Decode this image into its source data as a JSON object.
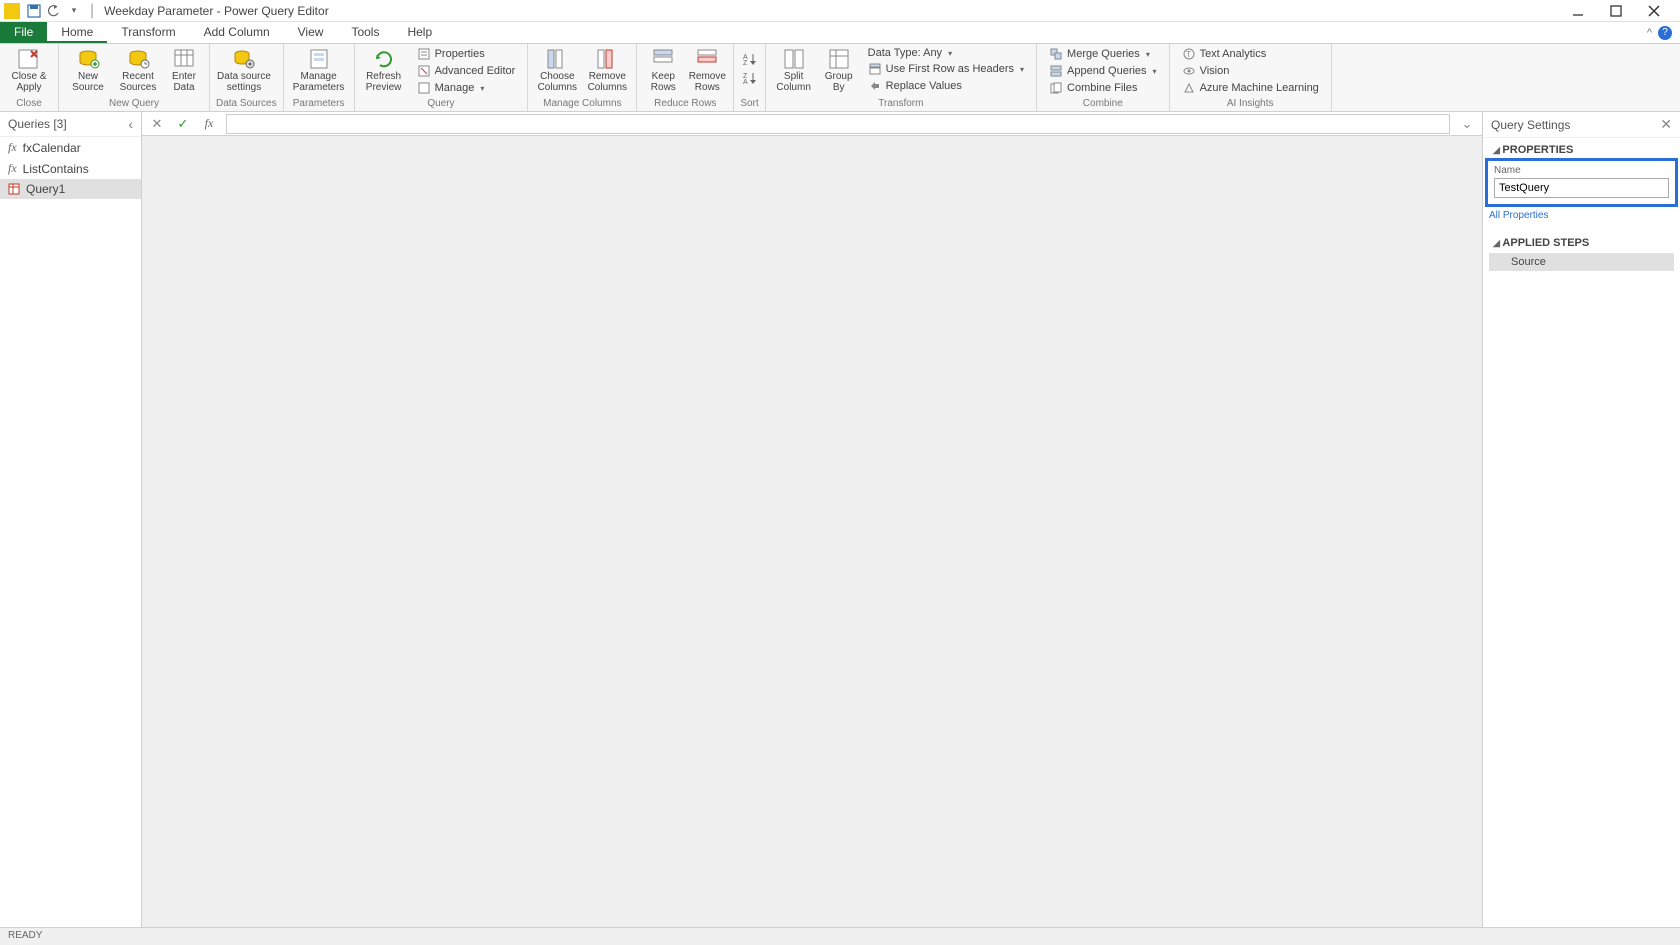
{
  "window": {
    "title": "Weekday Parameter - Power Query Editor",
    "status": "READY"
  },
  "tabs": {
    "file": "File",
    "home": "Home",
    "transform": "Transform",
    "addcol": "Add Column",
    "view": "View",
    "tools": "Tools",
    "help": "Help"
  },
  "ribbon": {
    "close_apply": "Close &\nApply",
    "close_grp": "Close",
    "new_source": "New\nSource",
    "recent_sources": "Recent\nSources",
    "enter_data": "Enter\nData",
    "new_query_grp": "New Query",
    "ds_settings": "Data source\nsettings",
    "ds_grp": "Data Sources",
    "manage_params": "Manage\nParameters",
    "params_grp": "Parameters",
    "refresh": "Refresh\nPreview",
    "properties": "Properties",
    "adv_editor": "Advanced Editor",
    "manage": "Manage",
    "query_grp": "Query",
    "choose_cols": "Choose\nColumns",
    "remove_cols": "Remove\nColumns",
    "mcols_grp": "Manage Columns",
    "keep_rows": "Keep\nRows",
    "remove_rows": "Remove\nRows",
    "rrows_grp": "Reduce Rows",
    "sort_grp": "Sort",
    "split_col": "Split\nColumn",
    "group_by": "Group\nBy",
    "data_type": "Data Type: Any",
    "first_row": "Use First Row as Headers",
    "replace_vals": "Replace Values",
    "transform_grp": "Transform",
    "merge_q": "Merge Queries",
    "append_q": "Append Queries",
    "combine_files": "Combine Files",
    "combine_grp": "Combine",
    "text_analytics": "Text Analytics",
    "vision": "Vision",
    "aml": "Azure Machine Learning",
    "ai_grp": "AI Insights"
  },
  "queries": {
    "header": "Queries [3]",
    "items": [
      {
        "name": "fxCalendar",
        "type": "fx"
      },
      {
        "name": "ListContains",
        "type": "fx"
      },
      {
        "name": "Query1",
        "type": "table"
      }
    ]
  },
  "settings": {
    "header": "Query Settings",
    "props_title": "PROPERTIES",
    "name_label": "Name",
    "name_value": "TestQuery",
    "all_props": "All Properties",
    "steps_title": "APPLIED STEPS",
    "step0": "Source"
  }
}
